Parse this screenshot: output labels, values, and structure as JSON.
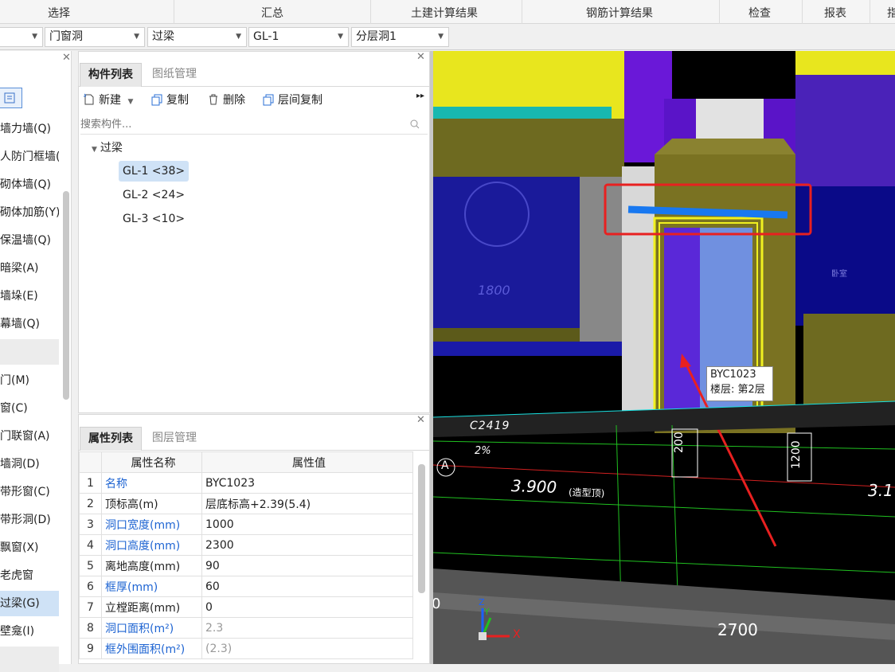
{
  "ribbon": {
    "groups": [
      "选择",
      "汇总",
      "土建计算结果",
      "钢筋计算结果",
      "检查",
      "报表",
      "指"
    ]
  },
  "filters": {
    "combo1": "",
    "combo2": "门窗洞",
    "combo3": "过梁",
    "combo4": "GL-1",
    "combo5": "分层洞1"
  },
  "categories": {
    "items": [
      "墙力墙(Q)",
      "人防门框墙(.",
      "砌体墙(Q)",
      "砌体加筋(Y)",
      "保温墙(Q)",
      "暗梁(A)",
      "墙垛(E)",
      "幕墙(Q)",
      "门(M)",
      "窗(C)",
      "门联窗(A)",
      "墙洞(D)",
      "带形窗(C)",
      "带形洞(D)",
      "飘窗(X)",
      "老虎窗",
      "过梁(G)",
      "壁龛(I)"
    ],
    "selected": "过梁(G)"
  },
  "component_panel": {
    "tab_active": "构件列表",
    "tab_inactive": "图纸管理",
    "new_label": "新建",
    "copy_label": "复制",
    "delete_label": "删除",
    "floor_copy_label": "层间复制",
    "search_placeholder": "搜索构件...",
    "tree_root": "过梁",
    "tree_items": [
      "GL-1 <38>",
      "GL-2 <24>",
      "GL-3 <10>"
    ]
  },
  "property_panel": {
    "tab_active": "属性列表",
    "tab_inactive": "图层管理",
    "col_name": "属性名称",
    "col_value": "属性值",
    "rows": [
      {
        "n": "1",
        "name": "名称",
        "value": "BYC1023"
      },
      {
        "n": "2",
        "name": "顶标高(m)",
        "value": "层底标高+2.39(5.4)"
      },
      {
        "n": "3",
        "name": "洞口宽度(mm)",
        "value": "1000"
      },
      {
        "n": "4",
        "name": "洞口高度(mm)",
        "value": "2300"
      },
      {
        "n": "5",
        "name": "离地高度(mm)",
        "value": "90"
      },
      {
        "n": "6",
        "name": "框厚(mm)",
        "value": "60"
      },
      {
        "n": "7",
        "name": "立樘距离(mm)",
        "value": "0"
      },
      {
        "n": "8",
        "name": "洞口面积(m²)",
        "value": "2.3"
      },
      {
        "n": "9",
        "name": "框外围面积(m²)",
        "value": "(2.3)"
      }
    ]
  },
  "viewport": {
    "tooltip_line1": "BYC1023",
    "tooltip_line2": "楼层: 第2层",
    "label_c2419": "C2419",
    "label_1800": "1800",
    "label_200": "200",
    "label_1200": "1200",
    "label_3900": "3.900",
    "label_3900_note": "(造型顶)",
    "label_31": "3.1",
    "label_2700": "2700",
    "label_0": "0",
    "label_a": "A",
    "label_x": "X",
    "label_y": "Y",
    "label_z": "Z",
    "label_2pct": "2%",
    "label_bedroom": "卧室"
  }
}
